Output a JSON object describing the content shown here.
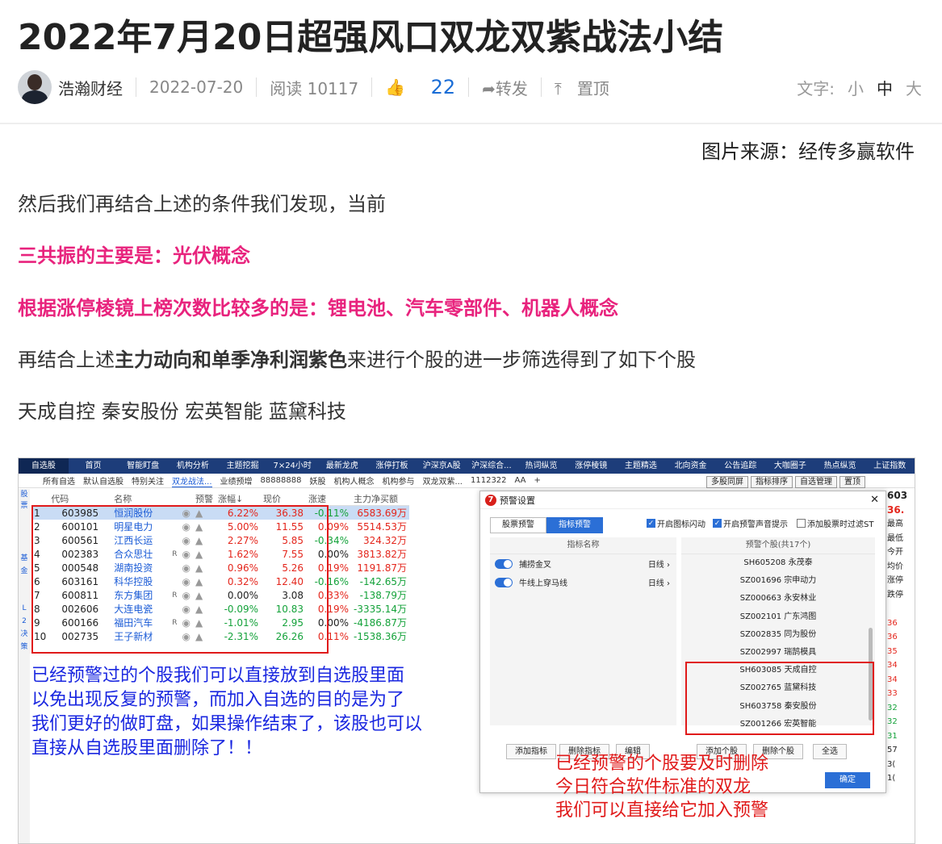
{
  "article": {
    "title": "2022年7月20日超强风口双龙双紫战法小结",
    "author": "浩瀚财经",
    "date": "2022-07-20",
    "read_label": "阅读",
    "read_count": "10117",
    "like_count": "22",
    "share_label": "转发",
    "pin_label": "置顶",
    "font_label": "文字:",
    "font_small": "小",
    "font_mid": "中",
    "font_large": "大",
    "source": "图片来源：经传多赢软件",
    "para1": "然后我们再结合上述的条件我们发现，当前",
    "para2": "三共振的主要是：光伏概念",
    "para3": "根据涨停棱镜上榜次数比较多的是：锂电池、汽车零部件、机器人概念",
    "para4_pre": "再结合上述",
    "para4_bold": "主力动向和单季净利润紫色",
    "para4_post": "来进行个股的进一步筛选得到了如下个股",
    "para5": "天成自控 秦安股份 宏英智能 蓝黛科技"
  },
  "software": {
    "top_nav": [
      "自选股",
      "首页",
      "智能盯盘",
      "机构分析",
      "主题挖掘",
      "7×24小时",
      "最新龙虎",
      "涨停打板",
      "沪深京A股",
      "沪深综合...",
      "热词纵览",
      "涨停棱镜",
      "主题精选",
      "北向资金",
      "公告追踪",
      "大咖圈子",
      "热点纵览",
      "上证指数"
    ],
    "sub_tabs": [
      "所有自选",
      "默认自选股",
      "特别关注",
      "双龙战法...",
      "业绩预增",
      "88888888",
      "妖股",
      "机构人概念",
      "机构参与",
      "双龙双紫...",
      "1112322",
      "AA",
      "+"
    ],
    "right_buttons": [
      "多股同屏",
      "指标排序",
      "自选管理",
      "置顶"
    ],
    "side_labels": [
      "股",
      "票",
      "基",
      "金",
      "L",
      "2",
      "决",
      "策"
    ],
    "table_headers": [
      "",
      "代码",
      "名称",
      "",
      "",
      "预警",
      "涨幅↓",
      "现价",
      "涨速",
      "主力净买额"
    ],
    "rows": [
      {
        "i": "1",
        "code": "603985",
        "name": "恒润股份",
        "tag": "",
        "pct": "6.22%",
        "price": "36.38",
        "speed": "-0.11%",
        "net": "6583.69万",
        "pc": "r",
        "sc": "g",
        "nc": "r"
      },
      {
        "i": "2",
        "code": "600101",
        "name": "明星电力",
        "tag": "",
        "pct": "5.00%",
        "price": "11.55",
        "speed": "0.09%",
        "net": "5514.53万",
        "pc": "r",
        "sc": "r",
        "nc": "r"
      },
      {
        "i": "3",
        "code": "600561",
        "name": "江西长运",
        "tag": "",
        "pct": "2.27%",
        "price": "5.85",
        "speed": "-0.34%",
        "net": "324.32万",
        "pc": "r",
        "sc": "g",
        "nc": "r"
      },
      {
        "i": "4",
        "code": "002383",
        "name": "合众思壮",
        "tag": "R",
        "pct": "1.62%",
        "price": "7.55",
        "speed": "0.00%",
        "net": "3813.82万",
        "pc": "r",
        "sc": "k",
        "nc": "r"
      },
      {
        "i": "5",
        "code": "000548",
        "name": "湖南投资",
        "tag": "",
        "pct": "0.96%",
        "price": "5.26",
        "speed": "0.19%",
        "net": "1191.87万",
        "pc": "r",
        "sc": "r",
        "nc": "r"
      },
      {
        "i": "6",
        "code": "603161",
        "name": "科华控股",
        "tag": "",
        "pct": "0.32%",
        "price": "12.40",
        "speed": "-0.16%",
        "net": "-142.65万",
        "pc": "r",
        "sc": "g",
        "nc": "g"
      },
      {
        "i": "7",
        "code": "600811",
        "name": "东方集团",
        "tag": "R",
        "pct": "0.00%",
        "price": "3.08",
        "speed": "0.33%",
        "net": "-138.79万",
        "pc": "k",
        "sc": "r",
        "nc": "g"
      },
      {
        "i": "8",
        "code": "002606",
        "name": "大连电瓷",
        "tag": "",
        "pct": "-0.09%",
        "price": "10.83",
        "speed": "0.19%",
        "net": "-3335.14万",
        "pc": "g",
        "sc": "r",
        "nc": "g"
      },
      {
        "i": "9",
        "code": "600166",
        "name": "福田汽车",
        "tag": "R",
        "pct": "-1.01%",
        "price": "2.95",
        "speed": "0.00%",
        "net": "-4186.87万",
        "pc": "g",
        "sc": "k",
        "nc": "g"
      },
      {
        "i": "10",
        "code": "002735",
        "name": "王子新材",
        "tag": "",
        "pct": "-2.31%",
        "price": "26.26",
        "speed": "0.11%",
        "net": "-1538.36万",
        "pc": "g",
        "sc": "r",
        "nc": "g"
      }
    ],
    "dialog": {
      "title": "预警设置",
      "tab1": "股票预警",
      "tab2": "指标预警",
      "check1": "开启图标闪动",
      "check2": "开启预警声音提示",
      "check3": "添加股票时过滤ST",
      "left_header": "指标名称",
      "indicators": [
        {
          "name": "捕捞金叉",
          "period": "日线"
        },
        {
          "name": "牛线上穿马线",
          "period": "日线"
        }
      ],
      "right_header": "预警个股(共17个)",
      "stocks": [
        {
          "code": "SH605208",
          "name": "永茂泰"
        },
        {
          "code": "SZ001696",
          "name": "宗申动力"
        },
        {
          "code": "SZ000663",
          "name": "永安林业"
        },
        {
          "code": "SZ002101",
          "name": "广东鸿图"
        },
        {
          "code": "SZ002835",
          "name": "同为股份"
        },
        {
          "code": "SZ002997",
          "name": "瑞鹄模具"
        },
        {
          "code": "SH603085",
          "name": "天成自控"
        },
        {
          "code": "SZ002765",
          "name": "蓝黛科技"
        },
        {
          "code": "SH603758",
          "name": "秦安股份"
        },
        {
          "code": "SZ001266",
          "name": "宏英智能"
        }
      ],
      "btn_add_ind": "添加指标",
      "btn_del_ind": "删除指标",
      "btn_edit": "编辑",
      "btn_add_stock": "添加个股",
      "btn_del_stock": "删除个股",
      "btn_all": "全选",
      "btn_ok": "确定"
    },
    "right_quote": [
      "603",
      "36.",
      "最高",
      "最低",
      "今开",
      "均价",
      "涨停",
      "跌停",
      "",
      "36",
      "36",
      "35",
      "34",
      "34",
      "33",
      "32",
      "32",
      "31",
      "57",
      "3(",
      "1(",
      "",
      "",
      "",
      "",
      "47",
      "",
      "28"
    ],
    "note_blue": [
      "已经预警过的个股我们可以直接放到自选股里面",
      "以免出现反复的预警，而加入自选的目的是为了",
      "我们更好的做盯盘，如果操作结束了，该股也可以",
      "直接从自选股里面删除了！！"
    ],
    "note_red": [
      "已经预警的个股要及时删除",
      "今日符合软件标准的双龙",
      "我们可以直接给它加入预警"
    ]
  }
}
